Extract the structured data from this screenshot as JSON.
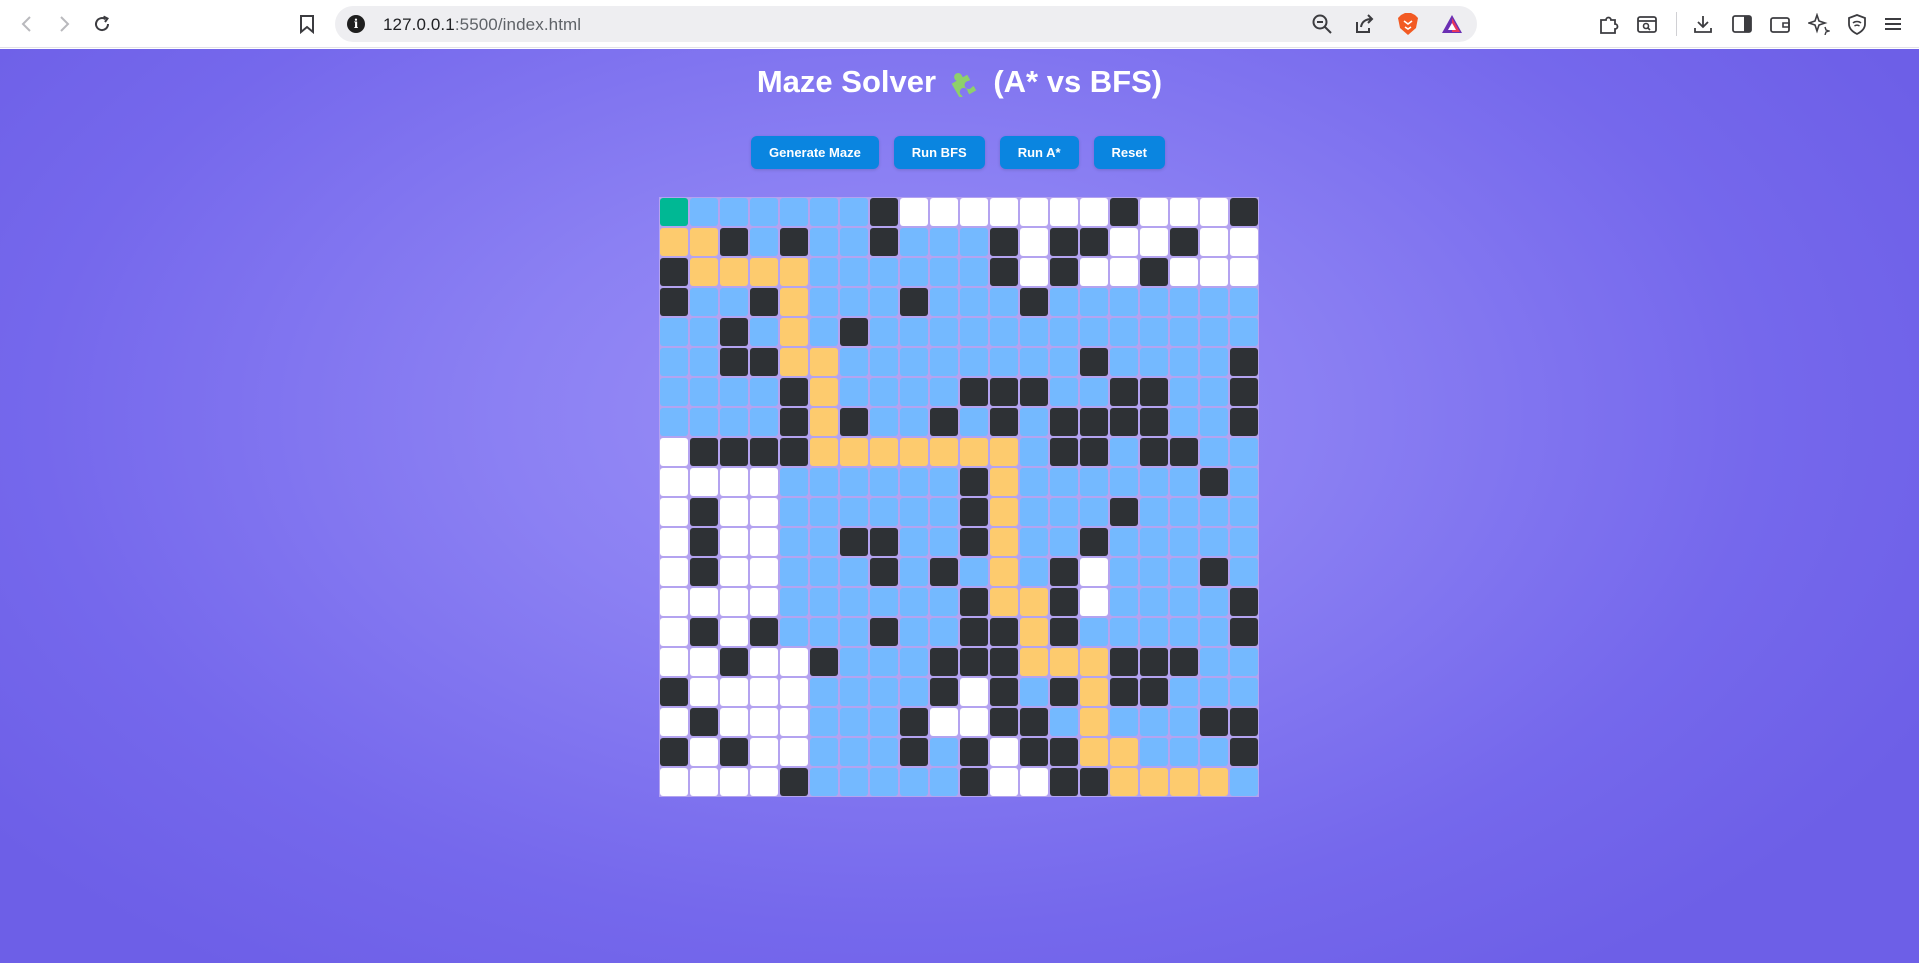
{
  "browser": {
    "url_host": "127.0.0.1",
    "url_path": ":5500/index.html"
  },
  "page": {
    "title": "Maze Solver",
    "title_suffix": "(A* vs BFS)",
    "title_icon": "puzzle-icon"
  },
  "controls": {
    "generate": "Generate Maze",
    "bfs": "Run BFS",
    "astar": "Run A*",
    "reset": "Reset"
  },
  "colors": {
    "page_background": "#8b80f3",
    "button": "#0a85e0",
    "wall": "#2e3135",
    "open": "#ffffff",
    "visited": "#74b9ff",
    "path": "#fdcb6e",
    "start": "#00b894"
  },
  "maze": {
    "legend": {
      "W": "wall",
      "O": "open",
      "V": "visited",
      "P": "path",
      "S": "start"
    },
    "rows": [
      "SVVVVVVWOOOOOOOWOOOW",
      "PPWVWVVWVVVWOWWOOWOO",
      "WPPPPVVVVVVWOWOOWOOO",
      "WVVWPVVVWVVVWVVVVVVV",
      "VVWVPVWVVVVVVVVVVVVV",
      "VVWWPPVVVVVVVVWVVVVW",
      "VVVVWPVVVVWWWVVWWVVW",
      "VVVVWPWVVWVWVWWWWVVW",
      "OWWWWPPPPPPPVWWVWWVV",
      "OOOOVVVVVVWPVVVVVVWV",
      "OWOOVVVVVVWPVVVWVVVV",
      "OWOOVVWWVVWPVVWVVVVV",
      "OWOOVVVWVWVPVWOVVVWV",
      "OOOOVVVVVVWPPWOVVVVW",
      "OWOWVVVWVVWWPWVVVVVW",
      "OOWOOWVVVWWWPPPWWWVV",
      "WOOOOVVVVWOWVWPWWVVV",
      "OWOOOVVVWOOWWVPVVVWW",
      "WOWOOVVVWVWOWWPPVVVW",
      "OOOOWVVVVVWOOWWPPPPV"
    ]
  }
}
